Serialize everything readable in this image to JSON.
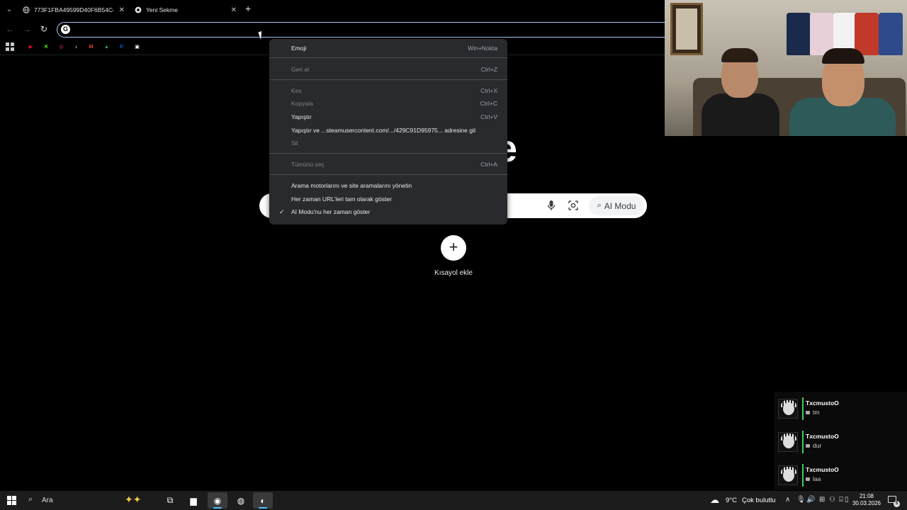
{
  "tabs": [
    {
      "title": "773F1FBA49599D40F6B54C45",
      "close": "✕"
    },
    {
      "title": "Yeni Sekme",
      "close": "✕"
    }
  ],
  "new_tab_symbol": "+",
  "toolbar": {
    "back_icon": "←",
    "forward_icon": "→",
    "reload_icon": "↻",
    "omnibox_value": "",
    "omnibox_g": "G"
  },
  "bookmarks": [
    {
      "icon": "youtube-icon",
      "glyph": "▶",
      "color": "#ff0033"
    },
    {
      "icon": "kick-icon",
      "glyph": "K",
      "color": "#53fc18"
    },
    {
      "icon": "instagram-icon",
      "glyph": "◎",
      "color": "#e1306c"
    },
    {
      "icon": "tiktok-icon",
      "glyph": "♪",
      "color": "#ffffff"
    },
    {
      "icon": "gmail-icon",
      "glyph": "M",
      "color": "#ea4335"
    },
    {
      "icon": "drive-icon",
      "glyph": "▲",
      "color": "#34a853"
    },
    {
      "icon": "messenger-icon",
      "glyph": "✆",
      "color": "#0a7cff"
    },
    {
      "icon": "extension-icon",
      "glyph": "▣",
      "color": "#ffffff"
    }
  ],
  "page": {
    "logo_fragment": "e",
    "ai_mode_label": "AI Modu",
    "ai_mode_glyph": "⌕",
    "shortcut_add_symbol": "+",
    "shortcut_label": "Kısayol ekle"
  },
  "context_menu": {
    "items": [
      {
        "label": "Emoji",
        "shortcut": "Win+Nokta",
        "enabled": true
      },
      {
        "label": "Geri al",
        "shortcut": "Ctrl+Z",
        "enabled": false
      },
      {
        "label": "Kes",
        "shortcut": "Ctrl+X",
        "enabled": false
      },
      {
        "label": "Kopyala",
        "shortcut": "Ctrl+C",
        "enabled": false
      },
      {
        "label": "Yapıştır",
        "shortcut": "Ctrl+V",
        "enabled": true
      },
      {
        "label": "Yapıştır ve ...steamusercontent.com/.../429C91D95975... adresine git",
        "shortcut": "",
        "enabled": true
      },
      {
        "label": "Sil",
        "shortcut": "",
        "enabled": false
      },
      {
        "label": "Tümünü seç",
        "shortcut": "Ctrl+A",
        "enabled": false
      },
      {
        "label": "Arama motorlarını ve site aramalarını yönetin",
        "shortcut": "",
        "enabled": true
      },
      {
        "label": "Her zaman URL'leri tam olarak göster",
        "shortcut": "",
        "enabled": true
      },
      {
        "label": "AI Modu'nu her zaman göster",
        "shortcut": "",
        "enabled": true,
        "checked": true
      }
    ],
    "check_glyph": "✓"
  },
  "chat": {
    "messages": [
      {
        "user": "TxcmustoO",
        "text": "tm"
      },
      {
        "user": "TxcmustoO",
        "text": "dur"
      },
      {
        "user": "TxcmustoO",
        "text": "laa"
      }
    ],
    "accent_color": "#3ccf5a"
  },
  "taskbar": {
    "search_placeholder": "Ara",
    "search_icon": "⌕",
    "copilot_glyph": "✦✦",
    "apps": [
      {
        "name": "task-view-icon",
        "glyph": "⧉",
        "active": false
      },
      {
        "name": "file-explorer-icon",
        "glyph": "▆",
        "active": false
      },
      {
        "name": "chrome-icon",
        "glyph": "◉",
        "active": true
      },
      {
        "name": "obs-icon",
        "glyph": "◍",
        "active": false
      },
      {
        "name": "steam-icon",
        "glyph": "◐",
        "active": true
      }
    ],
    "weather": {
      "temp": "9°C",
      "condition": "Çok bulutlu",
      "icon_glyph": "☁"
    },
    "tray_glyphs": [
      "∧",
      "🎙",
      "🔊",
      "⊞",
      "⚇",
      "⌹",
      "▯"
    ],
    "clock": {
      "time": "21:08",
      "date": "30.03.2026"
    },
    "notification_count": "5"
  }
}
